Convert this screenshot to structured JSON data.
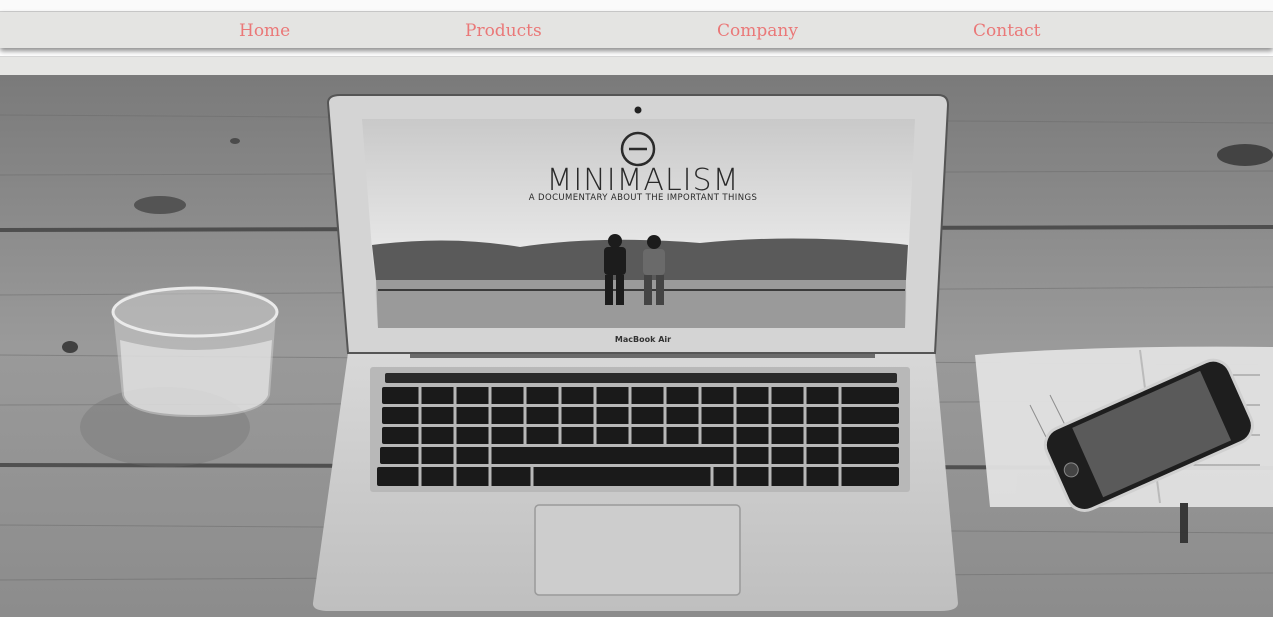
{
  "nav": {
    "items": [
      {
        "label": "Home"
      },
      {
        "label": "Products"
      },
      {
        "label": "Company"
      },
      {
        "label": "Contact"
      }
    ],
    "link_color": "#ea7878",
    "bar_color": "#e4e4e2"
  },
  "hero": {
    "screen_title": "MINIMALISM",
    "screen_subtitle": "A DOCUMENTARY ABOUT THE IMPORTANT THINGS",
    "laptop_label": "MacBook Air",
    "tone": "grayscale"
  }
}
